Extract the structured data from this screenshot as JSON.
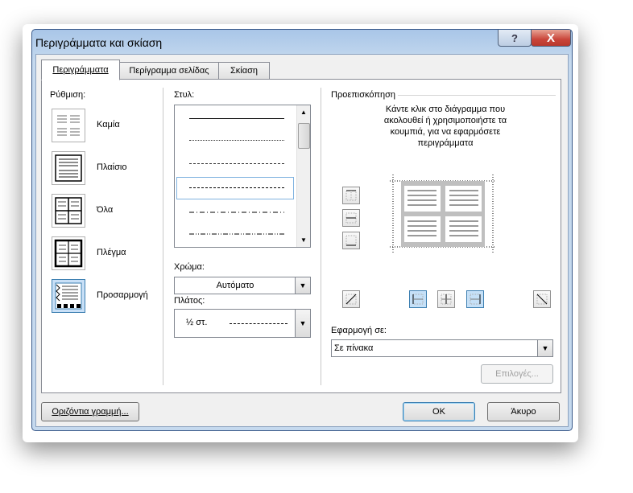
{
  "window": {
    "title": "Περιγράμματα και σκίαση",
    "help_label": "?",
    "close_label": "X"
  },
  "tabs": [
    {
      "label": "Περιγράμματα"
    },
    {
      "label": "Περίγραμμα σελίδας"
    },
    {
      "label": "Σκίαση"
    }
  ],
  "setting": {
    "label": "Ρύθμιση:",
    "items": [
      {
        "label": "Καμία"
      },
      {
        "label": "Πλαίσιο"
      },
      {
        "label": "Όλα"
      },
      {
        "label": "Πλέγμα"
      },
      {
        "label": "Προσαρμογή"
      }
    ],
    "selected": "Προσαρμογή"
  },
  "style": {
    "label": "Στυλ:",
    "lines": [
      "solid",
      "dotted",
      "dashed-small",
      "dashed",
      "dash-dot",
      "dash-dot-dot"
    ],
    "selected_index": 3
  },
  "color": {
    "label": "Χρώμα:",
    "value": "Αυτόματο"
  },
  "width": {
    "label": "Πλάτος:",
    "value": "½ στ."
  },
  "preview": {
    "label": "Προεπισκόπηση",
    "instructions": "Κάντε κλικ στο διάγραμμα που ακολουθεί ή χρησιμοποιήστε τα κουμπιά, για να εφαρμόσετε περιγράμματα"
  },
  "apply_to": {
    "label": "Εφαρμογή σε:",
    "value": "Σε πίνακα"
  },
  "buttons": {
    "options": "Επιλογές...",
    "horizontal_line": "Οριζόντια γραμμή...",
    "ok": "OK",
    "cancel": "Άκυρο"
  },
  "colors": {
    "accent": "#3c7fb1",
    "selection": "#c9e0f7",
    "title_bar": "#a9c6e8"
  }
}
